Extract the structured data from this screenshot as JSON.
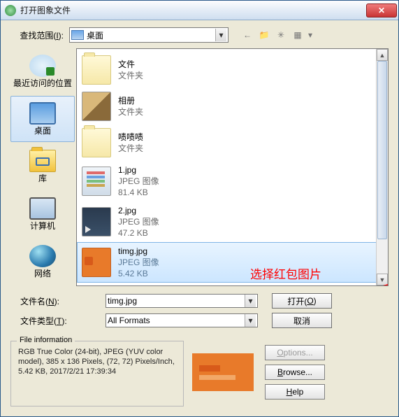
{
  "titlebar": {
    "text": "打开图象文件",
    "close_label": "✕"
  },
  "lookin": {
    "label_pre": "查找范围(",
    "label_key": "I",
    "label_post": "):",
    "value": "桌面"
  },
  "toolbar": {
    "back": "←",
    "up": "📁",
    "new": "✳",
    "view": "▦",
    "view_dd": "▾"
  },
  "places": [
    {
      "label": "最近访问的位置"
    },
    {
      "label": "桌面",
      "selected": true
    },
    {
      "label": "库"
    },
    {
      "label": "计算机"
    },
    {
      "label": "网络"
    }
  ],
  "filelist": [
    {
      "name": "文件",
      "sub": "文件夹",
      "size": "",
      "thumb": "folder"
    },
    {
      "name": "相册",
      "sub": "文件夹",
      "size": "",
      "thumb": "photo"
    },
    {
      "name": "啧啧啧",
      "sub": "文件夹",
      "size": "",
      "thumb": "folder"
    },
    {
      "name": "1.jpg",
      "sub": "JPEG 图像",
      "size": "81.4 KB",
      "thumb": "img1"
    },
    {
      "name": "2.jpg",
      "sub": "JPEG 图像",
      "size": "47.2 KB",
      "thumb": "img2"
    },
    {
      "name": "timg.jpg",
      "sub": "JPEG 图像",
      "size": "5.42 KB",
      "thumb": "timg",
      "selected": true
    }
  ],
  "annotation": {
    "text": "选择红包图片"
  },
  "filename": {
    "label_pre": "文件名(",
    "label_key": "N",
    "label_post": "):",
    "value": "timg.jpg"
  },
  "filetype": {
    "label_pre": "文件类型(",
    "label_key": "T",
    "label_post": "):",
    "value": "All Formats"
  },
  "actions": {
    "open_pre": "打开(",
    "open_key": "O",
    "open_post": ")",
    "cancel": "取消"
  },
  "fileinfo": {
    "legend": "File information",
    "text": "RGB True Color (24-bit),  JPEG (YUV color model),  385 x 136 Pixels,  (72, 72) Pixels/Inch,  5.42 KB,  2017/2/21 17:39:34"
  },
  "sidebuttons": {
    "options_key": "O",
    "options_post": "ptions...",
    "browse_key": "B",
    "browse_post": "rowse...",
    "help_key": "H",
    "help_post": "elp"
  }
}
